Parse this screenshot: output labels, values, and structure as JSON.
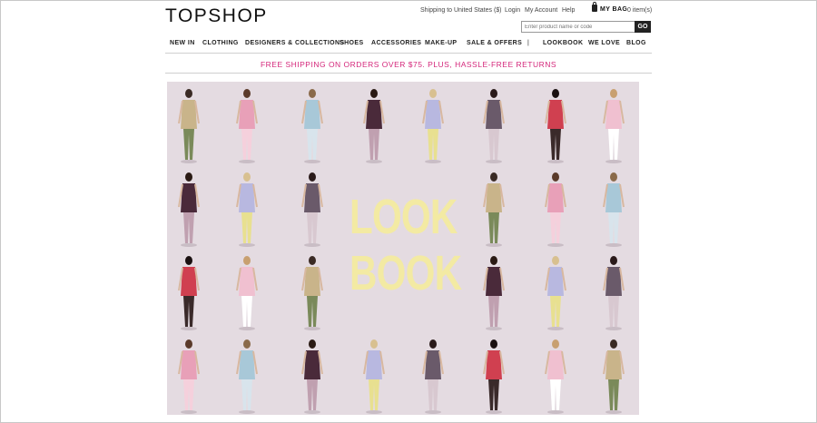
{
  "brand": {
    "logo_text": "TOPSHOP"
  },
  "utility": {
    "shipping": "Shipping to United States ($)",
    "login": "Login",
    "my_account": "My Account",
    "help": "Help",
    "bag_label": "MY BAG",
    "bag_count": "0 item(s)"
  },
  "search": {
    "placeholder": "Enter product name or code",
    "go_label": "GO"
  },
  "nav": {
    "items": [
      "NEW IN",
      "CLOTHING",
      "DESIGNERS & COLLECTIONS",
      "SHOES",
      "ACCESSORIES",
      "MAKE-UP",
      "SALE & OFFERS",
      "|",
      "LOOKBOOK",
      "WE LOVE",
      "BLOG"
    ]
  },
  "promo": {
    "text": "FREE SHIPPING ON ORDERS OVER $75. PLUS, HASSLE-FREE RETURNS"
  },
  "hero": {
    "title_line1": "LOOK",
    "title_line2": "BOOK",
    "title_color": "#f3eaa3",
    "background_color": "#e4dbe1"
  },
  "colors": {
    "accent": "#d4267a",
    "text": "#222222",
    "button": "#222222"
  }
}
